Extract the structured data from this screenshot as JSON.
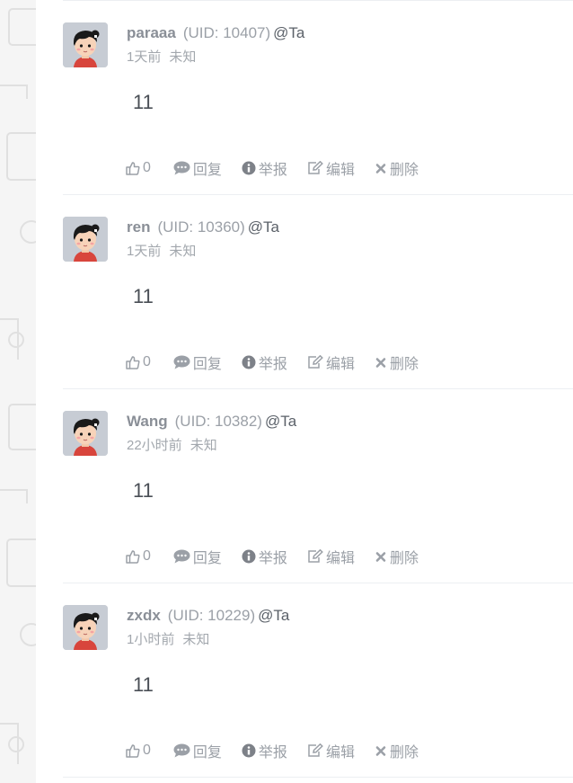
{
  "colors": {
    "divider": "#eceff2",
    "username": "#8a8f97",
    "muted": "#9ba0a7",
    "body_text": "#4a4f56",
    "avatar_bg": "#c7ccd4"
  },
  "actions": {
    "reply_label": "回复",
    "report_label": "举报",
    "edit_label": "编辑",
    "delete_label": "删除",
    "icons": [
      "thumbs-up-icon",
      "comment-bubble-icon",
      "info-circle-icon",
      "edit-icon",
      "close-icon"
    ]
  },
  "comments": [
    {
      "username": "paraaa",
      "uid": "(UID: 10407)",
      "mention": "@Ta",
      "time": "1天前",
      "location": "未知",
      "body": "11",
      "likes": "0"
    },
    {
      "username": "ren",
      "uid": "(UID: 10360)",
      "mention": "@Ta",
      "time": "1天前",
      "location": "未知",
      "body": "11",
      "likes": "0"
    },
    {
      "username": "Wang",
      "uid": "(UID: 10382)",
      "mention": "@Ta",
      "time": "22小时前",
      "location": "未知",
      "body": "11",
      "likes": "0"
    },
    {
      "username": "zxdx",
      "uid": "(UID: 10229)",
      "mention": "@Ta",
      "time": "1小时前",
      "location": "未知",
      "body": "11",
      "likes": "0"
    }
  ]
}
